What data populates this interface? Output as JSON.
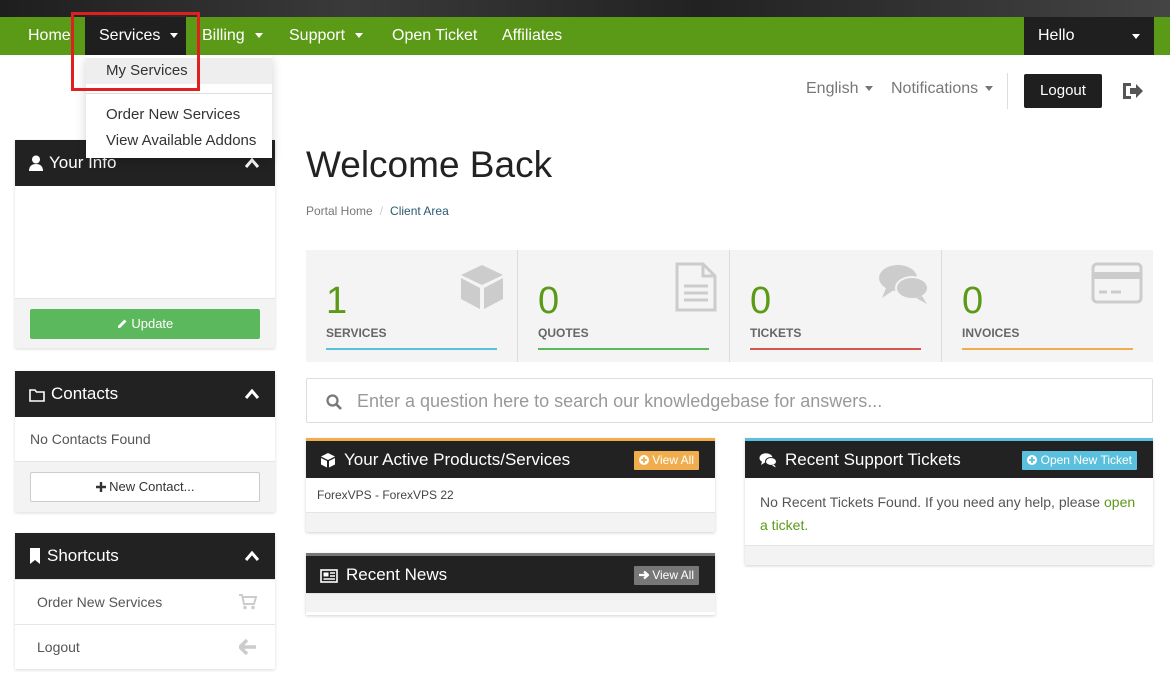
{
  "nav": {
    "home": "Home",
    "services": "Services",
    "billing": "Billing",
    "support": "Support",
    "open_ticket": "Open Ticket",
    "affiliates": "Affiliates",
    "hello": "Hello"
  },
  "services_menu": {
    "my_services": "My Services",
    "order_new": "Order New Services",
    "addons": "View Available Addons"
  },
  "util": {
    "language": "English",
    "notifications": "Notifications",
    "logout": "Logout"
  },
  "sidebar": {
    "your_info": {
      "title": "Your Info",
      "update": "Update"
    },
    "contacts": {
      "title": "Contacts",
      "empty": "No Contacts Found",
      "new_contact": "New Contact..."
    },
    "shortcuts": {
      "title": "Shortcuts",
      "items": [
        {
          "label": "Order New Services"
        },
        {
          "label": "Logout"
        }
      ]
    }
  },
  "page": {
    "title": "Welcome Back",
    "breadcrumb": [
      "Portal Home",
      "Client Area"
    ]
  },
  "stats": [
    {
      "value": "1",
      "label": "SERVICES",
      "color": "#5bc0de"
    },
    {
      "value": "0",
      "label": "QUOTES",
      "color": "#5cb85c"
    },
    {
      "value": "0",
      "label": "TICKETS",
      "color": "#d9534f"
    },
    {
      "value": "0",
      "label": "INVOICES",
      "color": "#f0ad4e"
    }
  ],
  "kb_search": {
    "placeholder": "Enter a question here to search our knowledgebase for answers..."
  },
  "products_panel": {
    "title": "Your Active Products/Services",
    "view_all": "View All",
    "items": [
      "ForexVPS - ForexVPS 22"
    ],
    "accent": "#f0ad4e"
  },
  "news_panel": {
    "title": "Recent News",
    "view_all": "View All",
    "accent": "#777777"
  },
  "tickets_panel": {
    "title": "Recent Support Tickets",
    "open_new": "Open New Ticket",
    "message": "No Recent Tickets Found. If you need any help, please",
    "link": "open a ticket",
    "end": ".",
    "accent": "#5bc0de"
  },
  "colors": {
    "brand": "#5b9a17",
    "dark": "#222222"
  }
}
